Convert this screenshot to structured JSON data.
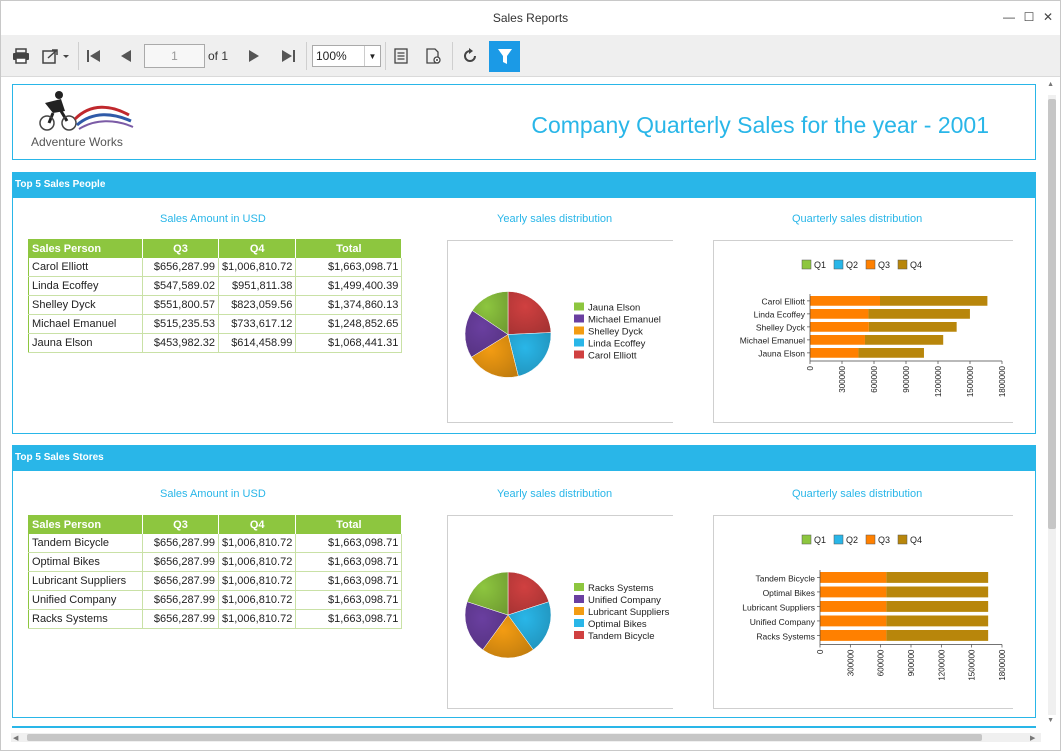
{
  "window": {
    "title": "Sales Reports"
  },
  "toolbar": {
    "page_value": "1",
    "of_label": "of",
    "page_total": "1",
    "zoom": "100%"
  },
  "header": {
    "logo_text": "Adventure Works",
    "report_title": "Company Quarterly Sales for the year - 2001"
  },
  "colors": {
    "accent": "#29b6e8",
    "table_header": "#8dc63f",
    "q1": "#8dc63f",
    "q2": "#29b6e8",
    "q3": "#ff8000",
    "q4": "#b8860b"
  },
  "sections": [
    {
      "title": "Top 5 Sales People",
      "table_title": "Sales Amount in USD",
      "pie_title": "Yearly sales distribution",
      "bar_title": "Quarterly sales distribution",
      "columns": [
        "Sales Person",
        "Q3",
        "Q4",
        "Total"
      ],
      "rows": [
        [
          "Carol Elliott",
          "$656,287.99",
          "$1,006,810.72",
          "$1,663,098.71"
        ],
        [
          "Linda Ecoffey",
          "$547,589.02",
          "$951,811.38",
          "$1,499,400.39"
        ],
        [
          "Shelley Dyck",
          "$551,800.57",
          "$823,059.56",
          "$1,374,860.13"
        ],
        [
          "Michael Emanuel",
          "$515,235.53",
          "$733,617.12",
          "$1,248,852.65"
        ],
        [
          "Jauna Elson",
          "$453,982.32",
          "$614,458.99",
          "$1,068,441.31"
        ]
      ]
    },
    {
      "title": "Top 5 Sales Stores",
      "table_title": "Sales Amount in USD",
      "pie_title": "Yearly sales distribution",
      "bar_title": "Quarterly sales distribution",
      "columns": [
        "Sales Person",
        "Q3",
        "Q4",
        "Total"
      ],
      "rows": [
        [
          "Tandem Bicycle",
          "$656,287.99",
          "$1,006,810.72",
          "$1,663,098.71"
        ],
        [
          "Optimal Bikes",
          "$656,287.99",
          "$1,006,810.72",
          "$1,663,098.71"
        ],
        [
          "Lubricant Suppliers",
          "$656,287.99",
          "$1,006,810.72",
          "$1,663,098.71"
        ],
        [
          "Unified Company",
          "$656,287.99",
          "$1,006,810.72",
          "$1,663,098.71"
        ],
        [
          "Racks Systems",
          "$656,287.99",
          "$1,006,810.72",
          "$1,663,098.71"
        ]
      ]
    }
  ],
  "chart_data": [
    {
      "type": "pie",
      "title": "Yearly sales distribution",
      "categories": [
        "Jauna Elson",
        "Michael Emanuel",
        "Shelley Dyck",
        "Linda Ecoffey",
        "Carol Elliott"
      ],
      "values": [
        1068441.31,
        1248852.65,
        1374860.13,
        1499400.39,
        1663098.71
      ],
      "colors": [
        "#8dc63f",
        "#6a3fa0",
        "#f39c12",
        "#29b6e8",
        "#d04040"
      ],
      "legend": "right"
    },
    {
      "type": "bar",
      "orientation": "horizontal",
      "stacked": true,
      "title": "Quarterly sales distribution",
      "categories": [
        "Carol Elliott",
        "Linda Ecoffey",
        "Shelley Dyck",
        "Michael Emanuel",
        "Jauna Elson"
      ],
      "series": [
        {
          "name": "Q1",
          "values": [
            0,
            0,
            0,
            0,
            0
          ],
          "color": "#8dc63f"
        },
        {
          "name": "Q2",
          "values": [
            0,
            0,
            0,
            0,
            0
          ],
          "color": "#29b6e8"
        },
        {
          "name": "Q3",
          "values": [
            656287.99,
            547589.02,
            551800.57,
            515235.53,
            453982.32
          ],
          "color": "#ff8000"
        },
        {
          "name": "Q4",
          "values": [
            1006810.72,
            951811.38,
            823059.56,
            733617.12,
            614458.99
          ],
          "color": "#b8860b"
        }
      ],
      "xlim": [
        0,
        1800000
      ],
      "xticks": [
        "0",
        "300000",
        "600000",
        "900000",
        "1200000",
        "1500000",
        "1800000"
      ],
      "legend": "top"
    },
    {
      "type": "pie",
      "title": "Yearly sales distribution",
      "categories": [
        "Racks Systems",
        "Unified Company",
        "Lubricant Suppliers",
        "Optimal Bikes",
        "Tandem Bicycle"
      ],
      "values": [
        1663098.71,
        1663098.71,
        1663098.71,
        1663098.71,
        1663098.71
      ],
      "colors": [
        "#8dc63f",
        "#6a3fa0",
        "#f39c12",
        "#29b6e8",
        "#d04040"
      ],
      "legend": "right"
    },
    {
      "type": "bar",
      "orientation": "horizontal",
      "stacked": true,
      "title": "Quarterly sales distribution",
      "categories": [
        "Tandem Bicycle",
        "Optimal Bikes",
        "Lubricant Suppliers",
        "Unified Company",
        "Racks Systems"
      ],
      "series": [
        {
          "name": "Q1",
          "values": [
            0,
            0,
            0,
            0,
            0
          ],
          "color": "#8dc63f"
        },
        {
          "name": "Q2",
          "values": [
            0,
            0,
            0,
            0,
            0
          ],
          "color": "#29b6e8"
        },
        {
          "name": "Q3",
          "values": [
            656287.99,
            656287.99,
            656287.99,
            656287.99,
            656287.99
          ],
          "color": "#ff8000"
        },
        {
          "name": "Q4",
          "values": [
            1006810.72,
            1006810.72,
            1006810.72,
            1006810.72,
            1006810.72
          ],
          "color": "#b8860b"
        }
      ],
      "xlim": [
        0,
        1800000
      ],
      "xticks": [
        "0",
        "300000",
        "600000",
        "900000",
        "1200000",
        "1500000",
        "1800000"
      ],
      "legend": "top"
    }
  ]
}
